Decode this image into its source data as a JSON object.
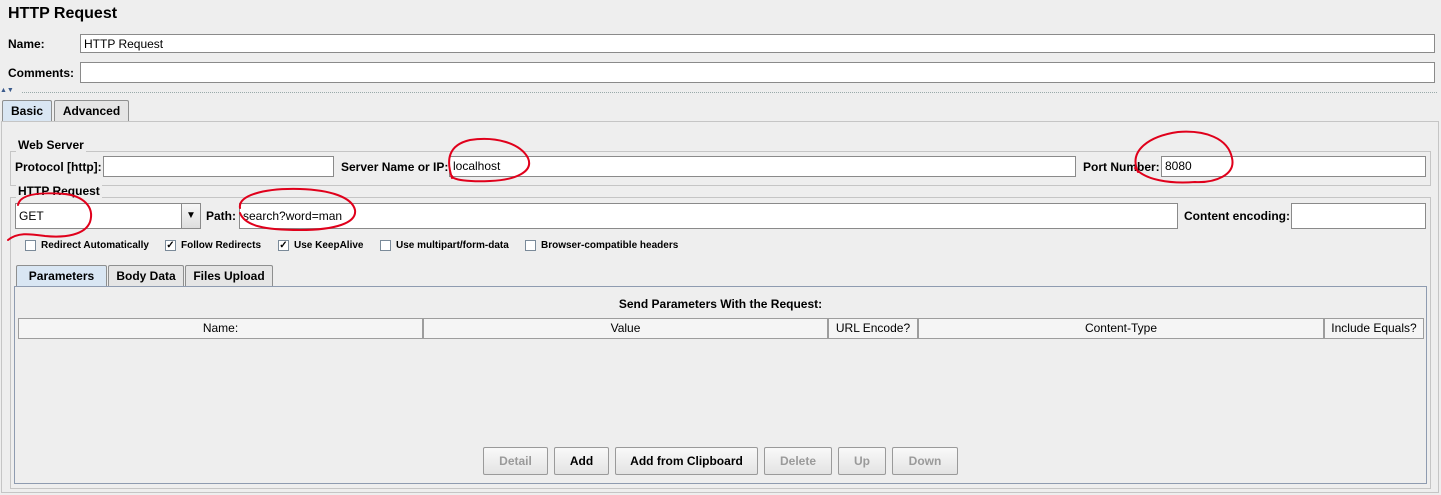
{
  "header": {
    "title": "HTTP Request",
    "name_label": "Name:",
    "name_value": "HTTP Request",
    "comments_label": "Comments:",
    "comments_value": ""
  },
  "tabs": [
    {
      "label": "Basic",
      "selected": true
    },
    {
      "label": "Advanced",
      "selected": false
    }
  ],
  "web_server": {
    "group_title": "Web Server",
    "protocol_label": "Protocol [http]:",
    "protocol_value": "",
    "server_label": "Server Name or IP:",
    "server_value": "localhost",
    "port_label": "Port Number:",
    "port_value": "8080"
  },
  "http_request": {
    "group_title": "HTTP Request",
    "method_value": "GET",
    "path_label": "Path:",
    "path_value": "search?word=man",
    "encoding_label": "Content encoding:",
    "encoding_value": "",
    "options": [
      {
        "label": "Redirect Automatically",
        "checked": false
      },
      {
        "label": "Follow Redirects",
        "checked": true
      },
      {
        "label": "Use KeepAlive",
        "checked": true
      },
      {
        "label": "Use multipart/form-data",
        "checked": false
      },
      {
        "label": "Browser-compatible headers",
        "checked": false
      }
    ]
  },
  "sub_tabs": [
    {
      "label": "Parameters",
      "selected": true
    },
    {
      "label": "Body Data",
      "selected": false
    },
    {
      "label": "Files Upload",
      "selected": false
    }
  ],
  "parameters": {
    "caption": "Send Parameters With the Request:",
    "columns": [
      "Name:",
      "Value",
      "URL Encode?",
      "Content-Type",
      "Include Equals?"
    ]
  },
  "buttons": [
    {
      "label": "Detail",
      "enabled": false
    },
    {
      "label": "Add",
      "enabled": true
    },
    {
      "label": "Add from Clipboard",
      "enabled": true
    },
    {
      "label": "Delete",
      "enabled": false
    },
    {
      "label": "Up",
      "enabled": false
    },
    {
      "label": "Down",
      "enabled": false
    }
  ],
  "colors": {
    "background": "#eeeeee",
    "annotation": "#e0001b",
    "selected_tab": "#d9e6f3"
  }
}
